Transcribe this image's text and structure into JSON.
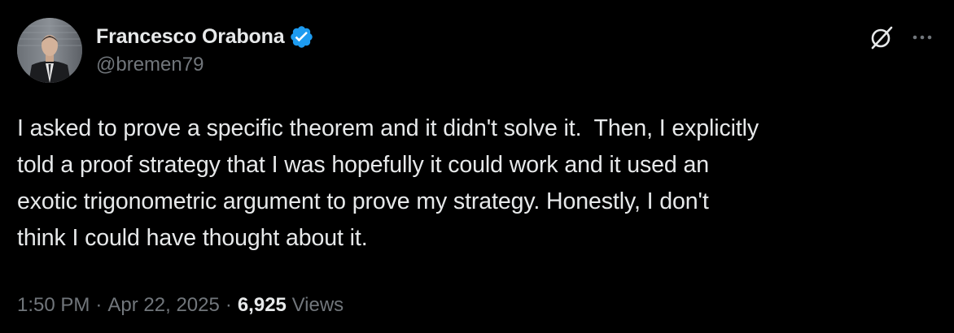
{
  "author": {
    "display_name": "Francesco Orabona",
    "handle": "@bremen79",
    "verified_icon": "verified-badge-icon",
    "verified_color": "#1d9bf0"
  },
  "tweet": {
    "text": "I asked to prove a specific theorem and it didn't solve it.  Then, I explicitly\ntold a proof strategy that I was hopefully it could work and it used an\nexotic trigonometric argument to prove my strategy. Honestly, I don't\nthink I could have thought about it."
  },
  "meta": {
    "time": "1:50 PM",
    "separator": "·",
    "date": "Apr 22, 2025",
    "views_count": "6,925",
    "views_label": "Views"
  },
  "icons": {
    "grok": "grok-icon",
    "more": "more-options-icon"
  },
  "colors": {
    "background": "#000000",
    "primary_text": "#e7e9ea",
    "secondary_text": "#71767b",
    "accent": "#1d9bf0"
  }
}
